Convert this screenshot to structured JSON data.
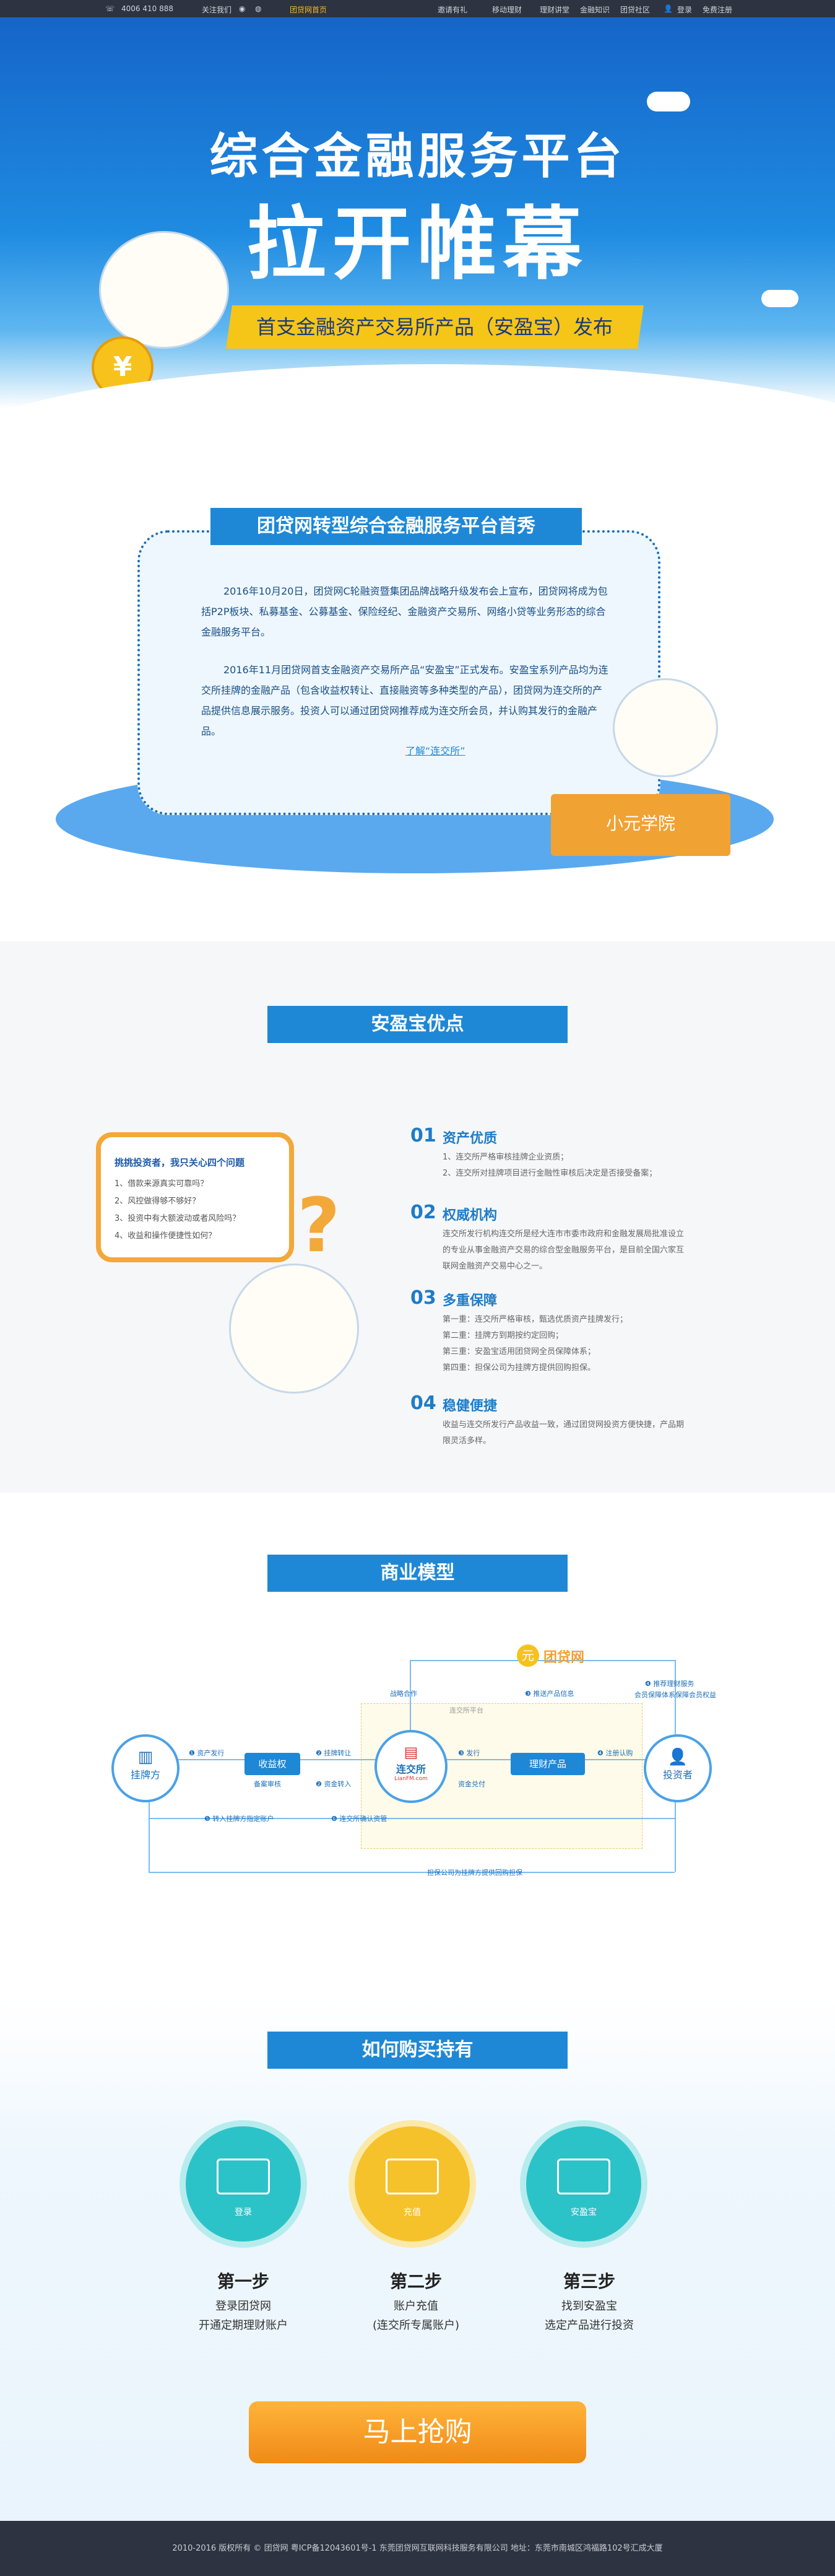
{
  "topbar": {
    "phone": "4006 410 888",
    "follow": "关注我们",
    "brand": "团贷网首页",
    "links": [
      "邀请有礼",
      "移动理财",
      "理财讲堂",
      "金融知识",
      "团贷社区"
    ],
    "login": "登录",
    "register": "免费注册"
  },
  "hero": {
    "title1": "综合金融服务平台",
    "title2": "拉开帷幕",
    "ribbon": "首支金融资产交易所产品（安盈宝）发布"
  },
  "intro": {
    "title": "团贷网转型综合金融服务平台首秀",
    "para1": "2016年10月20日，团贷网C轮融资暨集团品牌战略升级发布会上宣布，团贷网将成为包括P2P板块、私募基金、公募基金、保险经纪、金融资产交易所、网络小贷等业务形态的综合金融服务平台。",
    "para2": "2016年11月团贷网首支金融资产交易所产品“安盈宝”正式发布。安盈宝系列产品均为连交所挂牌的金融产品（包含收益权转让、直接融资等多种类型的产品），团贷网为连交所的产品提供信息展示服务。投资人可以通过团贷网推荐成为连交所会员，并认购其发行的金融产品。",
    "link": "了解“连交所”",
    "desk_label": "小元学院"
  },
  "advantages": {
    "title": "安盈宝优点",
    "bubble_title": "挑挑投资者，我只关心四个问题",
    "bubble_items": [
      "1、借款来源真实可靠吗？",
      "2、风控做得够不够好？",
      "3、投资中有大额波动或者风险吗？",
      "4、收益和操作便捷性如何？"
    ],
    "items": [
      {
        "num": "01",
        "title": "资产优质",
        "lines": [
          "1、连交所严格审核挂牌企业资质；",
          "2、连交所对挂牌项目进行金融性审核后决定是否接受备案；"
        ]
      },
      {
        "num": "02",
        "title": "权威机构",
        "lines": [
          "连交所发行机构连交所是经大连市市委市政府和金融发展局批准设立",
          "的专业从事金融资产交易的综合型金融服务平台，是目前全国六家互",
          "联网金融资产交易中心之一。"
        ]
      },
      {
        "num": "03",
        "title": "多重保障",
        "lines": [
          "第一重：连交所严格审核，甄选优质资产挂牌发行；",
          "第二重：挂牌方到期按约定回购；",
          "第三重：安盈宝适用团贷网全员保障体系；",
          "第四重：担保公司为挂牌方提供回购担保。"
        ]
      },
      {
        "num": "04",
        "title": "稳健便捷",
        "lines": [
          "收益与连交所发行产品收益一致，通过团贷网投资方便快捷，产品期",
          "限灵活多样。"
        ]
      }
    ]
  },
  "model": {
    "title": "商业模型",
    "logo": "团贷网",
    "nodes": {
      "listing": "挂牌方",
      "collect": "收益权",
      "exchange": "连交所",
      "exchange_sub": "LianFM.com",
      "product": "理财产品",
      "investor": "投资者",
      "frame": "连交所平台"
    },
    "labels": [
      "❶ 资产发行",
      "❷ 挂牌转让",
      "❸ 发行",
      "❹ 注册认购",
      "备案审核",
      "❷ 资金转入",
      "资金兑付",
      "❸ 推送产品信息",
      "❹ 推荐理财服务",
      "会员保障体系保障会员权益",
      "战略合作",
      "❺ 转入挂牌方指定账户",
      "❻ 连交所确认资管",
      "担保公司为挂牌方提供回购担保"
    ]
  },
  "buy": {
    "title": "如何购买持有",
    "steps": [
      {
        "icon_label": "登录",
        "title": "第一步",
        "desc1": "登录团贷网",
        "desc2": "开通定期理财账户",
        "color": "#2cc3c8"
      },
      {
        "icon_label": "充值",
        "title": "第二步",
        "desc1": "账户充值",
        "desc2": "(连交所专属账户)",
        "color": "#f5c22b"
      },
      {
        "icon_label": "安盈宝",
        "title": "第三步",
        "desc1": "找到安盈宝",
        "desc2": "选定产品进行投资",
        "color": "#2cc3c8"
      }
    ],
    "button": "马上抢购"
  },
  "footer": {
    "text": "2010-2016 版权所有 © 团贷网 粤ICP备12043601号-1 东莞团贷网互联网科技服务有限公司 地址：东莞市南城区鸿福路102号汇成大厦"
  }
}
